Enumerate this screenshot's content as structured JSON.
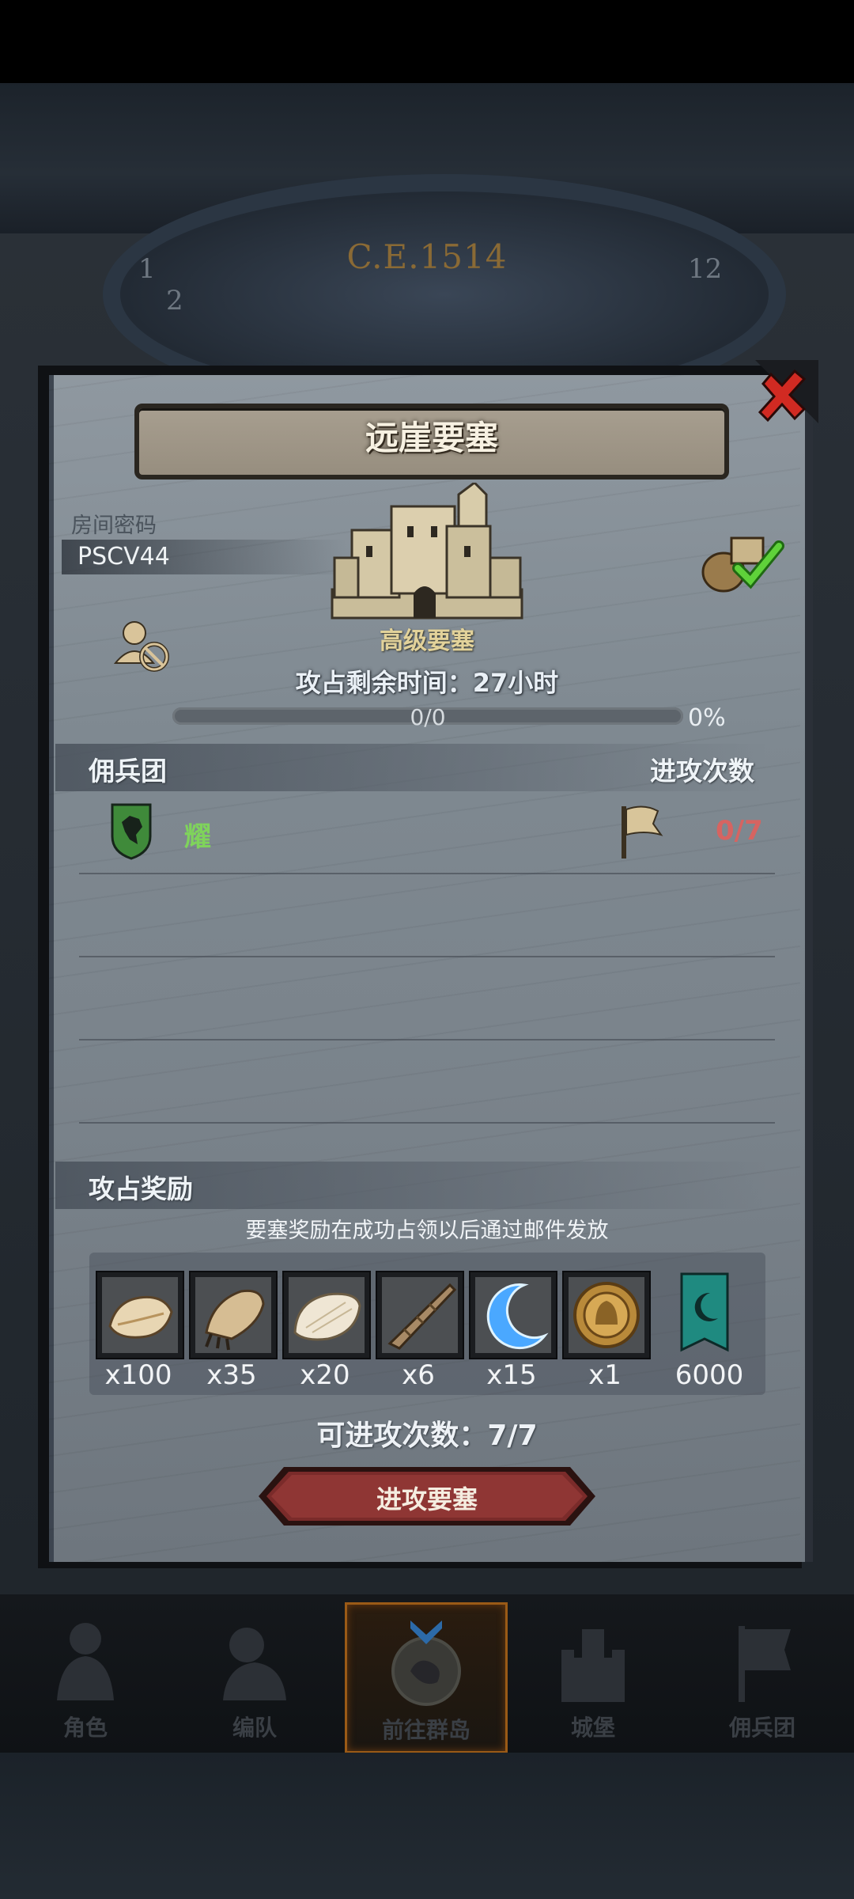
{
  "background": {
    "year": "C.E.1514"
  },
  "panel": {
    "title": "远崖要塞",
    "close_icon": "close-x-icon",
    "room_code_label": "房间密码",
    "room_code": "PSCV44",
    "fortress_type": "高级要塞",
    "remaining_time": "攻占剩余时间：27小时",
    "progress_text": "0/0",
    "progress_percent": "0%",
    "progress_fraction": 0
  },
  "mercenary_section": {
    "header_left": "佣兵团",
    "header_right": "进攻次数",
    "rows": [
      {
        "name": "耀",
        "count": "0/7"
      }
    ]
  },
  "reward_section": {
    "header": "攻占奖励",
    "note": "要塞奖励在成功占领以后通过邮件发放",
    "items": [
      {
        "icon": "fur-pelt-icon",
        "qty": "x100"
      },
      {
        "icon": "beast-claw-icon",
        "qty": "x35"
      },
      {
        "icon": "white-fur-icon",
        "qty": "x20"
      },
      {
        "icon": "horn-icon",
        "qty": "x6"
      },
      {
        "icon": "crescent-gem-icon",
        "qty": "x15"
      },
      {
        "icon": "gold-medal-icon",
        "qty": "x1"
      },
      {
        "icon": "guild-banner-icon",
        "qty": "6000"
      }
    ],
    "attempts": "可进攻次数：7/7",
    "attack_button": "进攻要塞"
  },
  "bottom_nav": [
    {
      "label": "角色",
      "icon": "character-icon",
      "active": false
    },
    {
      "label": "编队",
      "icon": "formation-icon",
      "active": false
    },
    {
      "label": "前往群岛",
      "icon": "islands-compass-icon",
      "active": true
    },
    {
      "label": "城堡",
      "icon": "castle-icon",
      "active": false
    },
    {
      "label": "佣兵团",
      "icon": "mercenary-icon",
      "active": false
    }
  ],
  "colors": {
    "accent_gold": "#e2d29a",
    "count_red": "#d66461",
    "merc_green": "#7fd35b",
    "button_red": "#7a2b2a"
  }
}
